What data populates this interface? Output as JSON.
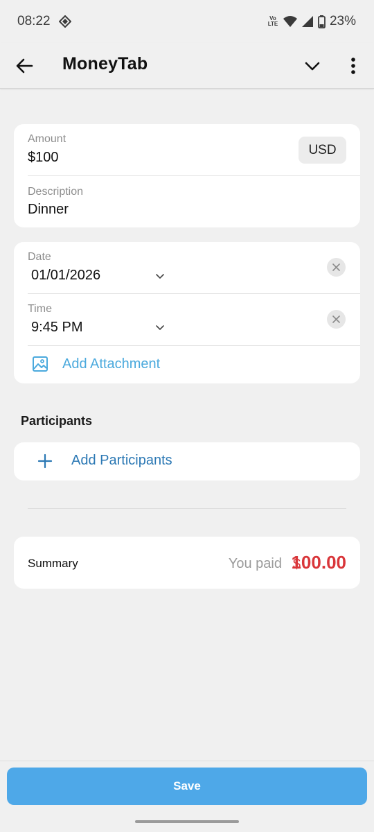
{
  "status_bar": {
    "time": "08:22",
    "network_label": "Vo LTE",
    "battery": "23%",
    "icons": [
      "app-notification-icon",
      "wifi-icon",
      "signal-icon",
      "battery-icon"
    ]
  },
  "app_bar": {
    "title": "MoneyTab",
    "icons": [
      "back-arrow-icon",
      "chevron-down-icon",
      "more-vert-icon"
    ]
  },
  "amount_card": {
    "amount_label": "Amount",
    "amount_value": "$100",
    "currency": "USD",
    "description_label": "Description",
    "description_value": "Dinner"
  },
  "datetime_card": {
    "date_label": "Date",
    "date_value": "01/01/2026",
    "time_label": "Time",
    "time_value": "9:45 PM",
    "attachment_label": "Add Attachment"
  },
  "participants": {
    "section_title": "Participants",
    "add_label": "Add Participants"
  },
  "summary": {
    "label": "Summary",
    "you_paid": "You paid",
    "currency_symbol": "$",
    "amount": "100.00"
  },
  "save_label": "Save",
  "colors": {
    "accent": "#4ea8e8",
    "link": "#4aa9dd",
    "link_dark": "#2b78b4",
    "negative": "#d9363a",
    "background": "#f0f0f0"
  }
}
